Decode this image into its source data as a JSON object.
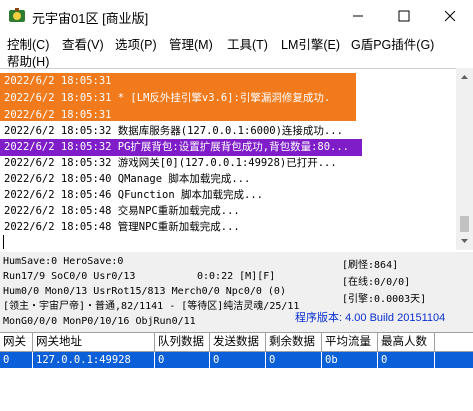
{
  "window": {
    "title": "元宇宙01区 [商业版]",
    "controls": [
      "minimize",
      "maximize",
      "close"
    ]
  },
  "menu": [
    {
      "label": "控制(C)"
    },
    {
      "label": "查看(V)"
    },
    {
      "label": "选项(P)"
    },
    {
      "label": "管理(M)"
    },
    {
      "label": "工具(T)"
    },
    {
      "label": "LM引擎(E)"
    },
    {
      "label": "G盾PG插件(G)"
    },
    {
      "label": "帮助(H)"
    }
  ],
  "log": [
    {
      "text": "2022/6/2 18:05:31",
      "style": "orange"
    },
    {
      "text": "2022/6/2 18:05:31 * [LM反外挂引擎v3.6]:引擎漏洞修复成功.",
      "style": "orange"
    },
    {
      "text": "2022/6/2 18:05:31",
      "style": "orange"
    },
    {
      "text": "2022/6/2 18:05:32 数据库服务器(127.0.0.1:6000)连接成功...",
      "style": "plain"
    },
    {
      "text": "2022/6/2 18:05:32 PG扩展背包:设置扩展背包成功,背包数量:80...",
      "style": "purple"
    },
    {
      "text": "2022/6/2 18:05:32 游戏网关[0](127.0.0.1:49928)已打开...",
      "style": "plain"
    },
    {
      "text": "2022/6/2 18:05:40 QManage 脚本加载完成...",
      "style": "plain"
    },
    {
      "text": "2022/6/2 18:05:46 QFunction 脚本加载完成...",
      "style": "plain"
    },
    {
      "text": "2022/6/2 18:05:48 交易NPC重新加载完成...",
      "style": "plain"
    },
    {
      "text": "2022/6/2 18:05:48 管理NPC重新加载完成...",
      "style": "plain"
    }
  ],
  "status": {
    "line1": "HumSave:0 HeroSave:0",
    "line2": "Run17/9 SoC0/0 Usr0/13",
    "time": "0:0:22 [M][F]",
    "line3": "Hum0/0 Mon0/13 UsrRot15/813 Merch0/0 Npc0/0 (0)",
    "line4": "[领主・宇宙尸帝]・普通,82/1141 - [等待区]纯洁灵魂/25/11",
    "line5": "MonG0/0/0 MonP0/10/16 ObjRun0/11",
    "refresh": "[刷怪:864]",
    "online": "[在线:0/0/0]",
    "engine": "[引擎:0.0003天]",
    "version": "程序版本: 4.00 Build 20151104"
  },
  "grid": {
    "headers": [
      "网关",
      "网关地址",
      "队列数据",
      "发送数据",
      "剩余数据",
      "平均流量",
      "最高人数"
    ],
    "rows": [
      [
        "0",
        "127.0.0.1:49928",
        "0",
        "0",
        "0",
        "0b",
        "0"
      ]
    ]
  },
  "colors": {
    "orange_highlight": "#f07a1c",
    "purple_highlight": "#7f1ec9",
    "selection_blue": "#0b5fd8",
    "version_text": "#0b2fd0"
  }
}
